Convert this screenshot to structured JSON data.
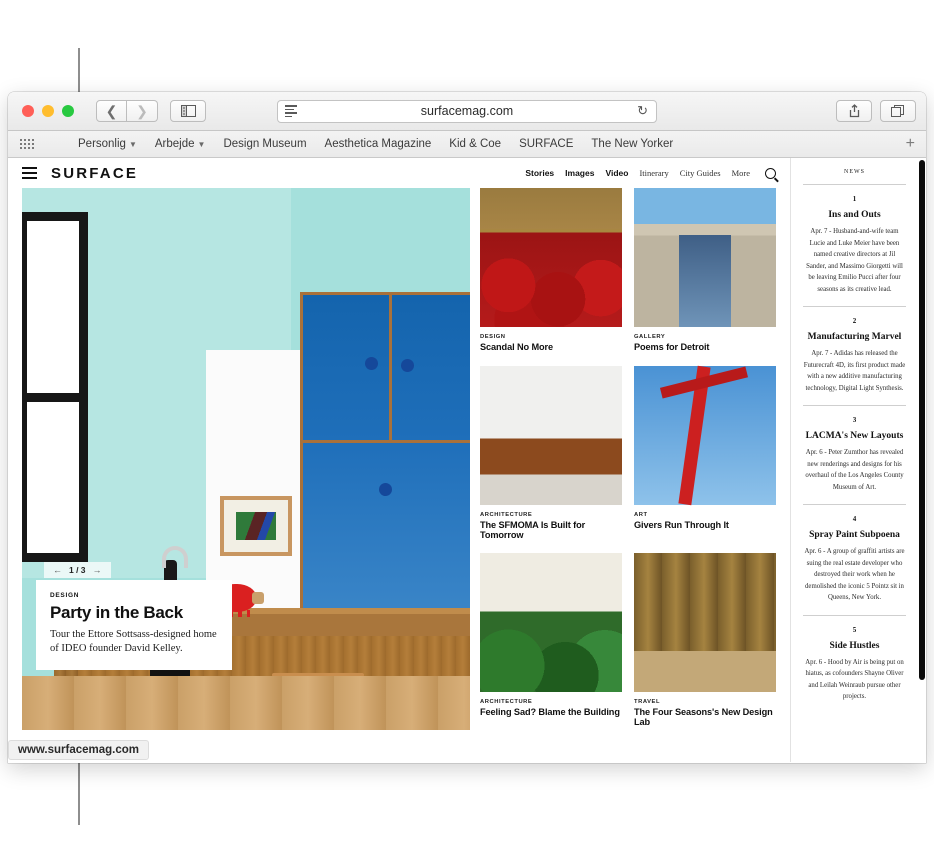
{
  "browser": {
    "url": "surfacemag.com",
    "window_controls": [
      "close",
      "minimize",
      "zoom"
    ],
    "toolbar": {
      "back_icon": "chevron-left-icon",
      "forward_icon": "chevron-right-icon",
      "sidebar_icon": "sidebar-icon",
      "reader_icon": "reader-view-icon",
      "reload_icon": "reload-icon",
      "share_icon": "share-icon",
      "tabs_icon": "show-tabs-icon"
    },
    "bookmarks": [
      {
        "label": "Personlig",
        "has_caret": true
      },
      {
        "label": "Arbejde",
        "has_caret": true
      },
      {
        "label": "Design Museum",
        "has_caret": false
      },
      {
        "label": "Aesthetica Magazine",
        "has_caret": false
      },
      {
        "label": "Kid & Coe",
        "has_caret": false
      },
      {
        "label": "SURFACE",
        "has_caret": false
      },
      {
        "label": "The New Yorker",
        "has_caret": false
      }
    ],
    "bookmarks_add_label": "+",
    "status_bar_url": "www.surfacemag.com"
  },
  "site": {
    "brand": "SURFACE",
    "menu_icon": "hamburger-menu-icon",
    "search_icon": "search-icon",
    "nav_primary": [
      "Stories",
      "Images",
      "Video"
    ],
    "nav_secondary": [
      "Itinerary",
      "City Guides",
      "More"
    ]
  },
  "hero": {
    "counter": "1 / 3",
    "prev_icon": "arrow-left-icon",
    "next_icon": "arrow-right-icon",
    "kicker": "DESIGN",
    "title": "Party in the Back",
    "dek": "Tour the Ettore Sottsass-designed home of IDEO founder David Kelley."
  },
  "articles": [
    {
      "kicker": "DESIGN",
      "title": "Scandal No More",
      "image": "theatre-red-seats"
    },
    {
      "kicker": "GALLERY",
      "title": "Poems for Detroit",
      "image": "gallery-building-facade"
    },
    {
      "kicker": "ARCHITECTURE",
      "title": "The SFMOMA Is Built for Tomorrow",
      "image": "sfmoma-interior"
    },
    {
      "kicker": "ART",
      "title": "Givers Run Through It",
      "image": "red-steel-sculpture"
    },
    {
      "kicker": "ARCHITECTURE",
      "title": "Feeling Sad? Blame the Building",
      "image": "plant-filled-interior"
    },
    {
      "kicker": "TRAVEL",
      "title": "The Four Seasons's New Design Lab",
      "image": "wood-bar-interior"
    }
  ],
  "news": {
    "heading": "NEWS",
    "items": [
      {
        "number": "1",
        "title": "Ins and Outs",
        "body": "Apr. 7 - Husband-and-wife team Lucie and Luke Meier have been named creative directors at Jil Sander, and Massimo Giorgetti will be leaving Emilio Pucci after four seasons as its creative lead."
      },
      {
        "number": "2",
        "title": "Manufacturing Marvel",
        "body": "Apr. 7 - Adidas has released the Futurecraft 4D, its first product made with a new additive manufacturing technology, Digital Light Synthesis."
      },
      {
        "number": "3",
        "title": "LACMA's New Layouts",
        "body": "Apr. 6 - Peter Zumthor has revealed new renderings and designs for his overhaul of the Los Angeles County Museum of Art."
      },
      {
        "number": "4",
        "title": "Spray Paint Subpoena",
        "body": "Apr. 6 - A group of graffiti artists are suing the real estate developer who destroyed their work when he demolished the iconic 5 Pointz sit in Queens, New York."
      },
      {
        "number": "5",
        "title": "Side Hustles",
        "body": "Apr. 6 - Hood by Air is being put on hiatus, as cofounders Shayne Oliver and Leilah Weinraub pursue other projects."
      }
    ]
  },
  "colors": {
    "traffic_close": "#ff5f57",
    "traffic_min": "#ffbd2e",
    "traffic_zoom": "#28c940",
    "toolbar_bg": "#f0f0f0",
    "page_bg": "#ffffff"
  }
}
